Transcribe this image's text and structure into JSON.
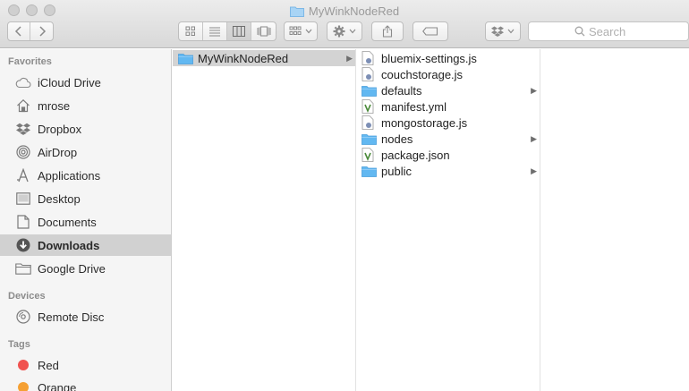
{
  "window": {
    "title": "MyWinkNodeRed"
  },
  "toolbar": {
    "search_placeholder": "Search",
    "back_icon": "chevron-left-icon",
    "forward_icon": "chevron-right-icon",
    "view_modes": [
      "icon-view",
      "list-view",
      "column-view",
      "cover-flow-view"
    ],
    "active_view": "column-view"
  },
  "sidebar": {
    "favorites_header": "Favorites",
    "favorites": [
      {
        "label": "iCloud Drive",
        "icon": "cloud-icon"
      },
      {
        "label": "mrose",
        "icon": "home-icon"
      },
      {
        "label": "Dropbox",
        "icon": "dropbox-icon"
      },
      {
        "label": "AirDrop",
        "icon": "airdrop-icon"
      },
      {
        "label": "Applications",
        "icon": "applications-icon"
      },
      {
        "label": "Desktop",
        "icon": "desktop-icon"
      },
      {
        "label": "Documents",
        "icon": "documents-icon"
      },
      {
        "label": "Downloads",
        "icon": "downloads-icon",
        "selected": true
      },
      {
        "label": "Google Drive",
        "icon": "folder-icon"
      }
    ],
    "devices_header": "Devices",
    "devices": [
      {
        "label": "Remote Disc",
        "icon": "disc-icon"
      }
    ],
    "tags_header": "Tags",
    "tags": [
      {
        "label": "Red",
        "color": "#f0524f"
      },
      {
        "label": "Orange",
        "color": "#f5a033"
      }
    ]
  },
  "columns": {
    "col1": [
      {
        "name": "MyWinkNodeRed",
        "type": "folder",
        "selected": true
      }
    ],
    "col2": [
      {
        "name": "bluemix-settings.js",
        "type": "js-file"
      },
      {
        "name": "couchstorage.js",
        "type": "js-file"
      },
      {
        "name": "defaults",
        "type": "folder"
      },
      {
        "name": "manifest.yml",
        "type": "yml-file"
      },
      {
        "name": "mongostorage.js",
        "type": "js-file"
      },
      {
        "name": "nodes",
        "type": "folder"
      },
      {
        "name": "package.json",
        "type": "json-file"
      },
      {
        "name": "public",
        "type": "folder"
      }
    ]
  },
  "colors": {
    "folder": "#5eb6f0",
    "selection": "#d3d3d3",
    "sidebar_bg": "#f5f5f5"
  }
}
